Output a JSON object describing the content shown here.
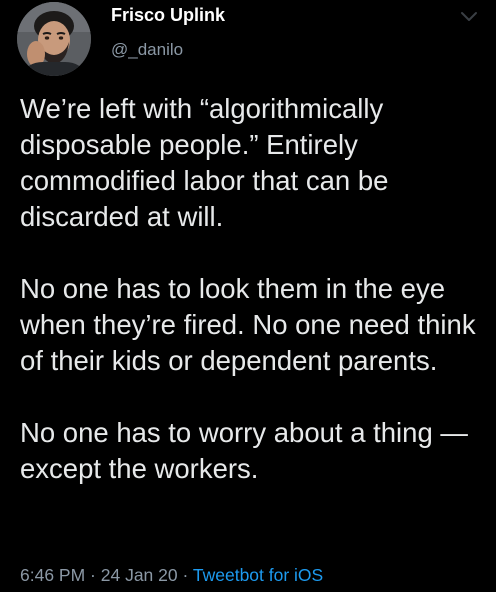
{
  "author": {
    "display_name": "Frisco Uplink",
    "handle": "@_danilo"
  },
  "tweet": {
    "paragraphs": [
      "We’re left with “algorithmically disposable people.” Entirely commodified labor that can be discarded at will.",
      "No one has to look them in the eye when they’re fired. No one need think of their kids or dependent parents.",
      "No one has to worry about a thing —except the workers."
    ],
    "time": "6:46 PM",
    "separator": " · ",
    "date": "24 Jan 20",
    "client": "Tweetbot for iOS"
  },
  "icons": {
    "avatar": "profile-photo",
    "menu": "chevron-down-icon"
  },
  "colors": {
    "background": "#000000",
    "text": "#e7e9ea",
    "secondary": "#8b98a5",
    "link": "#1d9bf0"
  }
}
